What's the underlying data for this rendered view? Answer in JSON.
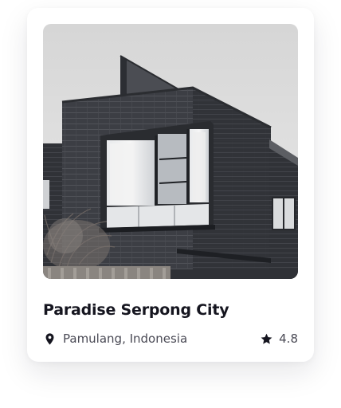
{
  "listing": {
    "title": "Paradise Serpong City",
    "location": "Pamulang, Indonesia",
    "rating": "4.8",
    "location_icon": "location-pin-icon",
    "rating_icon": "star-icon",
    "photo": "building-photo"
  },
  "colors": {
    "title_text": "#15151f",
    "secondary_text": "#4a4a55",
    "icon": "#15151f",
    "card_background": "#ffffff"
  }
}
